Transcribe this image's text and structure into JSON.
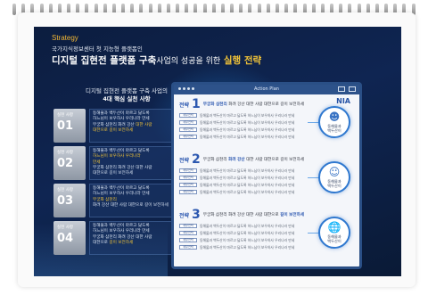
{
  "slide": {
    "strategy_label": "Strategy",
    "subtitle": "국가지식정보센터 첫 지능형 플랫폼인",
    "title_part1": "디지털 집현전 플랫폼 구축",
    "title_part2": "사업의 성공을 위한",
    "title_part3": "실행 전략"
  },
  "left": {
    "heading_line1": "디지털 집현전 플랫폼 구축 사업의",
    "heading_line2": "4대 핵심 실천 사항",
    "cards": [
      {
        "label": "실천 사항",
        "num": "01",
        "lines": [
          "동해물과 백두산이 마르고 닳도록",
          "하느님이 보우하사 우리나라 만세",
          "무궁화 삼천리 화려 강산"
        ],
        "highlight": "대한 사람",
        "tail": "대한으로 길이 보전하세"
      },
      {
        "label": "실천 사항",
        "num": "02",
        "lines": [
          "동해물과 백두산이 마르고 닳도록",
          "하느님이 보우하사 우리나라",
          "만세",
          "무궁화 삼천리 화려 강산 대한 사람"
        ],
        "highlight": "",
        "tail": "대한으로 길이 보전하세"
      },
      {
        "label": "실천 사항",
        "num": "03",
        "lines": [
          "동해물과 백두산이 마르고 닳도록",
          "하느님이 보우하사 우리나라 만세"
        ],
        "highlight": "무궁화 삼천리",
        "tail": "화려 강산 대한 사람 대한으로 길이 보전하세"
      },
      {
        "label": "실천 사항",
        "num": "04",
        "lines": [
          "동해물과 백두산이 마르고 닳도록",
          "하느님이 보우하사 우리나라 만세",
          "무궁화 삼천리 화려 강산 대한 사람"
        ],
        "highlight": "길이 보전하세",
        "tail": "대한으로"
      }
    ]
  },
  "panel": {
    "title": "Action Plan",
    "brand": "NIA",
    "item_line": "동해물과 백두산이 마르고 닳도록 하느님이 보우하사 우리나라 만세",
    "tag": "세부전략",
    "rows": [
      {
        "word": "전략",
        "num": "1",
        "head_pre": "",
        "head_hl": "무궁화 삼천리",
        "head_post": "화려 강산 대한 사람 대한으로 길이 보전하세"
      },
      {
        "word": "전략",
        "num": "2",
        "head_pre": "무궁화 삼천리",
        "head_hl": "화려 강산",
        "head_post": "대한 사람 대한으로 길이 보전하세"
      },
      {
        "word": "전략",
        "num": "3",
        "head_pre": "무궁화 삼천리 화려 강산 대한 사람 대한으로",
        "head_hl": "길이 보전하세",
        "head_post": ""
      }
    ],
    "badges": [
      {
        "caption1": "동해물과",
        "caption2": "백두산이"
      },
      {
        "caption1": "동해물과",
        "caption2": "백두산이"
      },
      {
        "caption1": "동해물과",
        "caption2": "백두산이"
      }
    ]
  }
}
